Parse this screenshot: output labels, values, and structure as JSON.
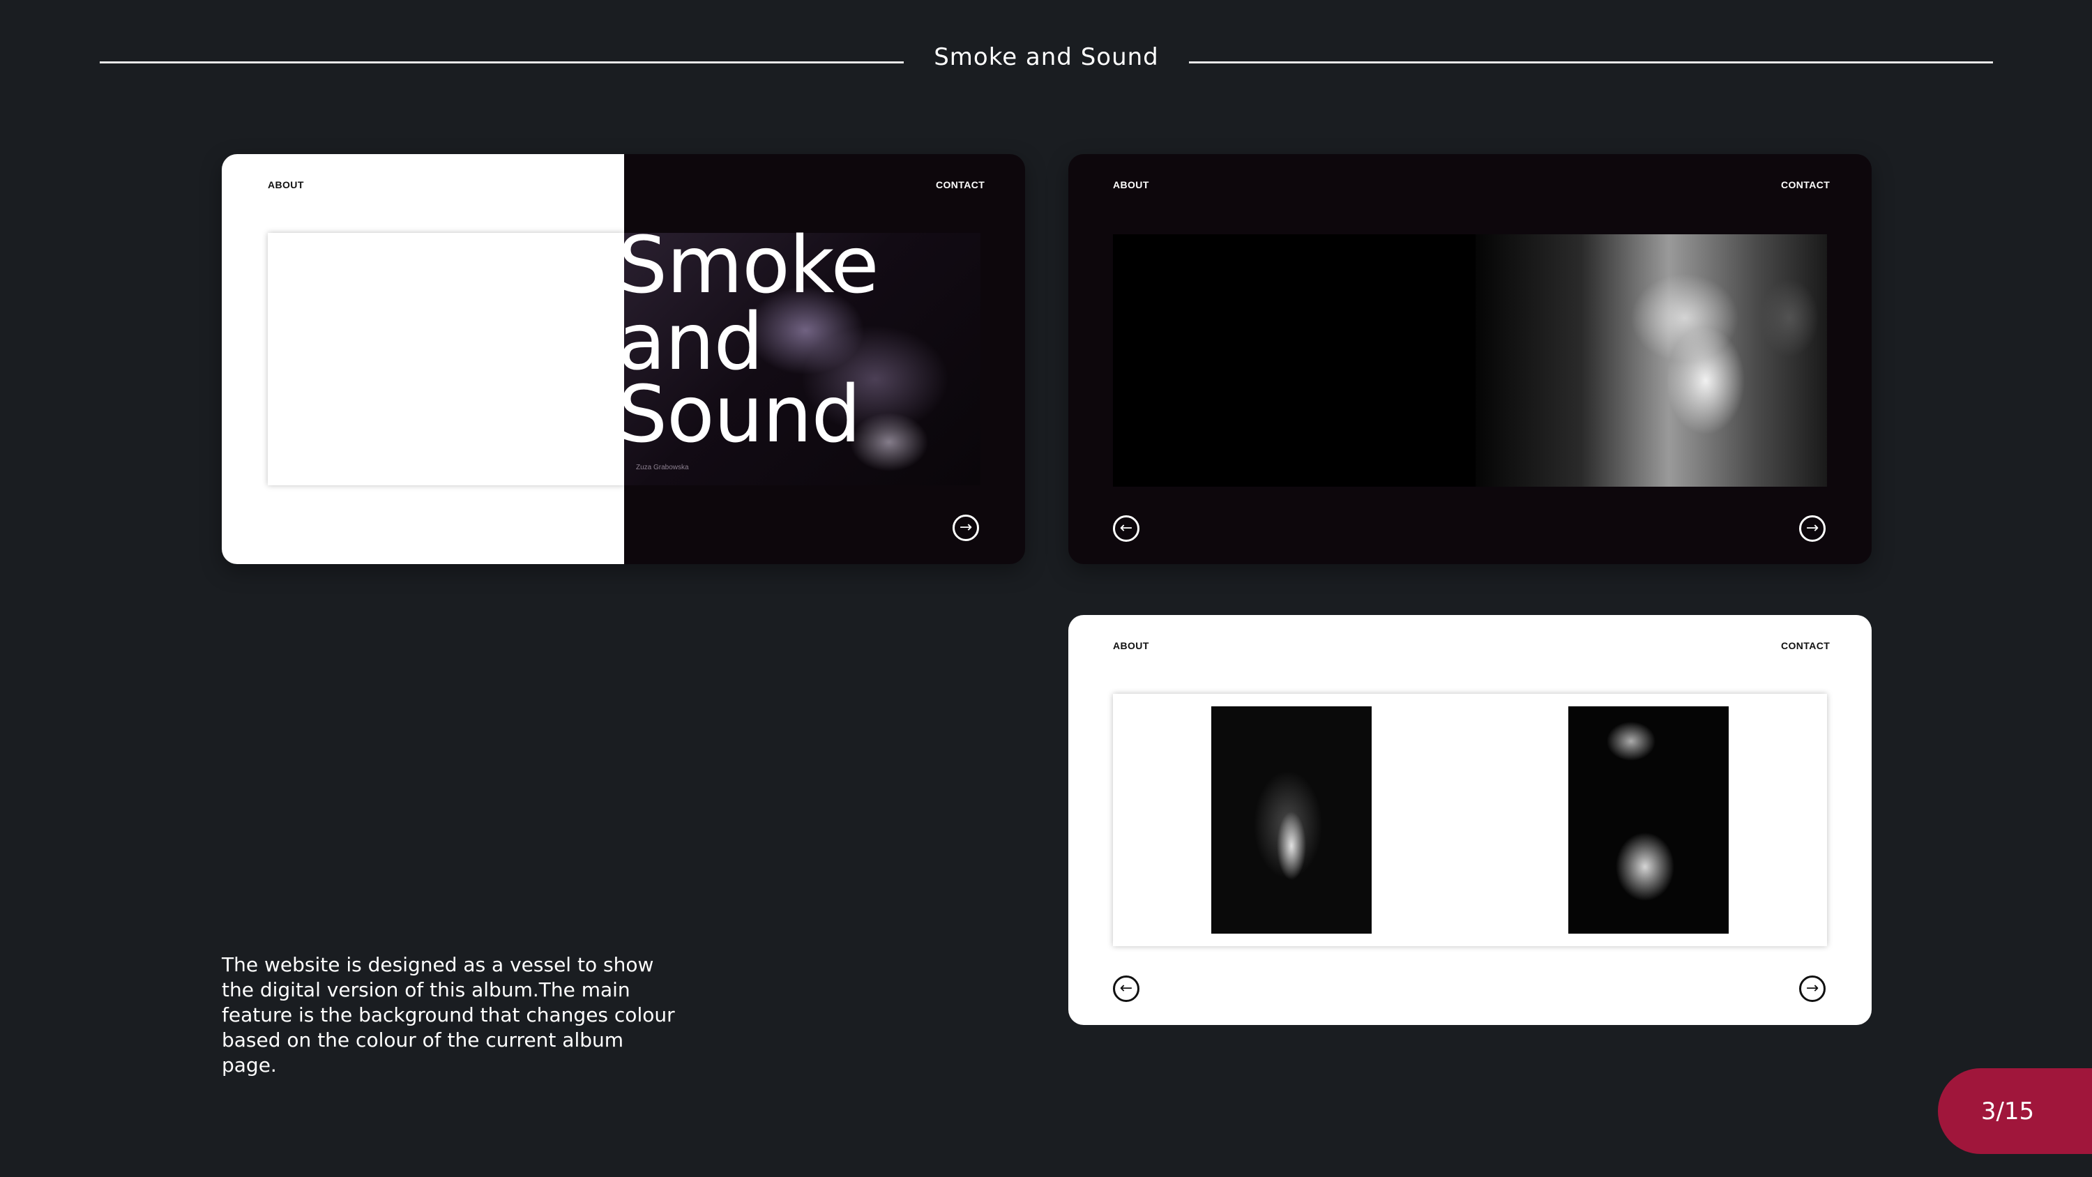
{
  "header": {
    "title": "Smoke and Sound"
  },
  "cards": [
    {
      "nav": {
        "about": "ABOUT",
        "contact": "CONTACT"
      },
      "hero_lines": [
        "Smoke",
        "and",
        "Sound"
      ],
      "credit": "Zuza Grabowska",
      "next_icon": "arrow-right-circle-icon"
    },
    {
      "nav": {
        "about": "ABOUT",
        "contact": "CONTACT"
      },
      "prev_icon": "arrow-left-circle-icon",
      "next_icon": "arrow-right-circle-icon"
    },
    {
      "nav": {
        "about": "ABOUT",
        "contact": "CONTACT"
      },
      "prev_icon": "arrow-left-circle-icon",
      "next_icon": "arrow-right-circle-icon"
    }
  ],
  "description": "The website is designed as a vessel to show the digital version of this album.The main feature is the background that changes colour based on the colour of the current album page.",
  "pagination": {
    "label": "3/15"
  },
  "colors": {
    "background": "#1a1d21",
    "accent": "#a0163b",
    "card_dark": "#0d070c"
  }
}
